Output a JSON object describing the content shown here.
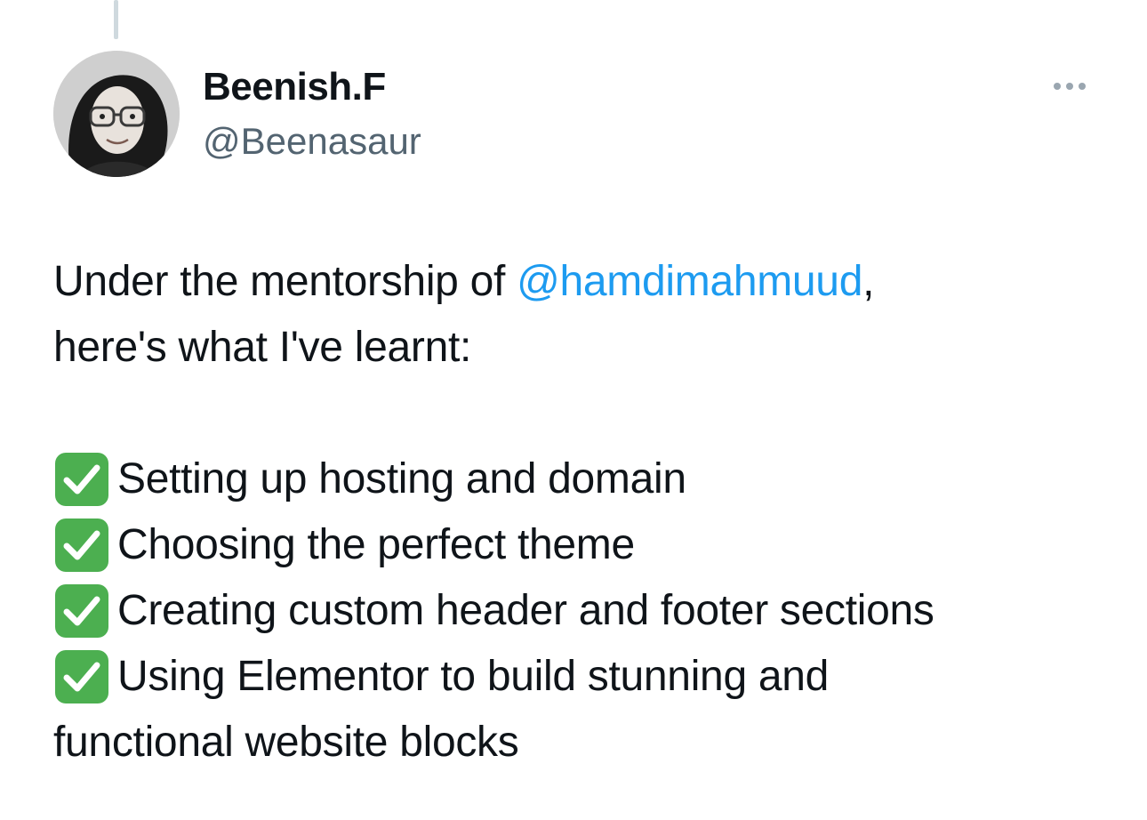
{
  "tweet": {
    "display_name": "Beenish.F",
    "handle": "@Beenasaur",
    "more_icon": "more-horizontal-icon",
    "avatar_icon": "avatar-photo",
    "text": {
      "intro_before_mention": "Under the mentorship of ",
      "mention": "@hamdimahmuud",
      "intro_after_mention": ",",
      "intro_line2": "here's what I've learnt:",
      "checklist_icon": "green-check-icon",
      "checklist": [
        "Setting up hosting and domain",
        "Choosing the perfect theme",
        "Creating custom header and footer sections",
        "Using Elementor to build stunning and"
      ],
      "final_line": "functional website blocks"
    }
  },
  "colors": {
    "link": "#1d9bf0",
    "handle": "#536471",
    "text": "#0f1419",
    "check_bg": "#4caf50",
    "thread_line": "#cfd9de"
  }
}
